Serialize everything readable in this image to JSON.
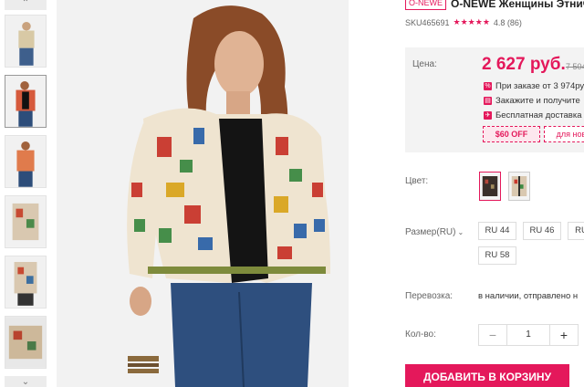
{
  "thumbnails": {
    "up_arrow": "⌃",
    "down_arrow": "⌄",
    "count": 6,
    "active_index": 1
  },
  "product": {
    "brand_badge": "O-NEWE",
    "title": "O-NEWE Женщины Этничес",
    "sku": "SKU465691",
    "stars": "★★★★★",
    "rating": "4.8 (86)"
  },
  "price": {
    "label": "Цена:",
    "current": "2 627 руб.",
    "old": "7 504",
    "promos": [
      {
        "icon": "%",
        "text": "При заказе от 3 974ру"
      },
      {
        "icon": "▤",
        "text": "Закажите и получите"
      },
      {
        "icon": "✈",
        "text": "Бесплатная доставка"
      }
    ],
    "coupon": "$60 OFF",
    "coupon_new": "для нов"
  },
  "color": {
    "label": "Цвет:",
    "active_index": 0
  },
  "size": {
    "label": "Размер(RU)",
    "chevron": "⌄",
    "options": [
      "RU 44",
      "RU 46",
      "RU",
      "RU 58"
    ]
  },
  "shipping": {
    "label": "Перевозка:",
    "value": "в наличии, отправлено н"
  },
  "quantity": {
    "label": "Кол-во:",
    "minus": "−",
    "value": "1",
    "plus": "+"
  },
  "add_to_cart": "ДОБАВИТЬ В КОРЗИНУ",
  "colors": {
    "accent": "#e4185b",
    "panel": "#f3f3f3"
  }
}
